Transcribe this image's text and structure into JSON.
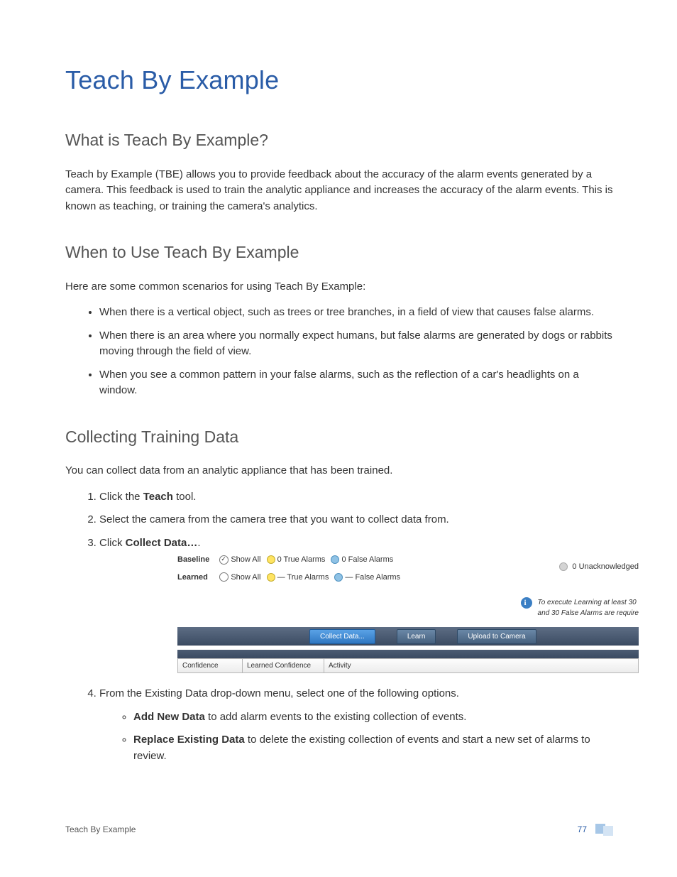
{
  "title": "Teach By Example",
  "sections": {
    "what": {
      "heading": "What is Teach By Example?",
      "body": "Teach by Example (TBE) allows you to provide feedback about the accuracy of the alarm events generated by a camera. This feedback is used to train the analytic appliance and increases the accuracy of the alarm events. This is known as teaching, or training the camera's analytics."
    },
    "when": {
      "heading": "When to Use Teach By Example",
      "intro": "Here are some common scenarios for using Teach By Example:",
      "bullets": [
        "When there is a vertical object, such as trees or tree branches, in a field of view that causes false alarms.",
        "When there is an area where you normally expect humans, but false alarms are generated by dogs or rabbits moving through the field of view.",
        "When you see a common pattern in your false alarms, such as the reflection of a car's headlights on a window."
      ]
    },
    "collect": {
      "heading": "Collecting Training Data",
      "intro": "You can collect data from an analytic appliance that has been trained.",
      "steps": {
        "s1a": "Click the ",
        "s1b": "Teach",
        "s1c": " tool.",
        "s2": "Select the camera from the camera tree that you want to collect data from.",
        "s3a": "Click ",
        "s3b": "Collect Data…",
        "s3c": ".",
        "s4": "From the Existing Data drop-down menu, select one of the following options.",
        "s4b1a": "Add New Data",
        "s4b1b": " to add alarm events to the existing collection of events.",
        "s4b2a": "Replace Existing Data",
        "s4b2b": " to delete the existing collection of events and start a new set of alarms to review."
      }
    }
  },
  "ui": {
    "baseline_label": "Baseline",
    "learned_label": "Learned",
    "show_all": "Show All",
    "true_alarms_0": "0  True Alarms",
    "false_alarms_0": "0  False Alarms",
    "true_alarms_d": "—  True Alarms",
    "false_alarms_d": "—  False Alarms",
    "unack": "0 Unacknowledged",
    "info_line1": "To execute Learning at least 30",
    "info_line2": "and 30 False Alarms are require",
    "btn_collect": "Collect Data...",
    "btn_learn": "Learn",
    "btn_upload": "Upload to Camera",
    "col_conf": "Confidence",
    "col_lconf": "Learned Confidence",
    "col_activity": "Activity"
  },
  "footer": {
    "title": "Teach By Example",
    "page": "77"
  }
}
